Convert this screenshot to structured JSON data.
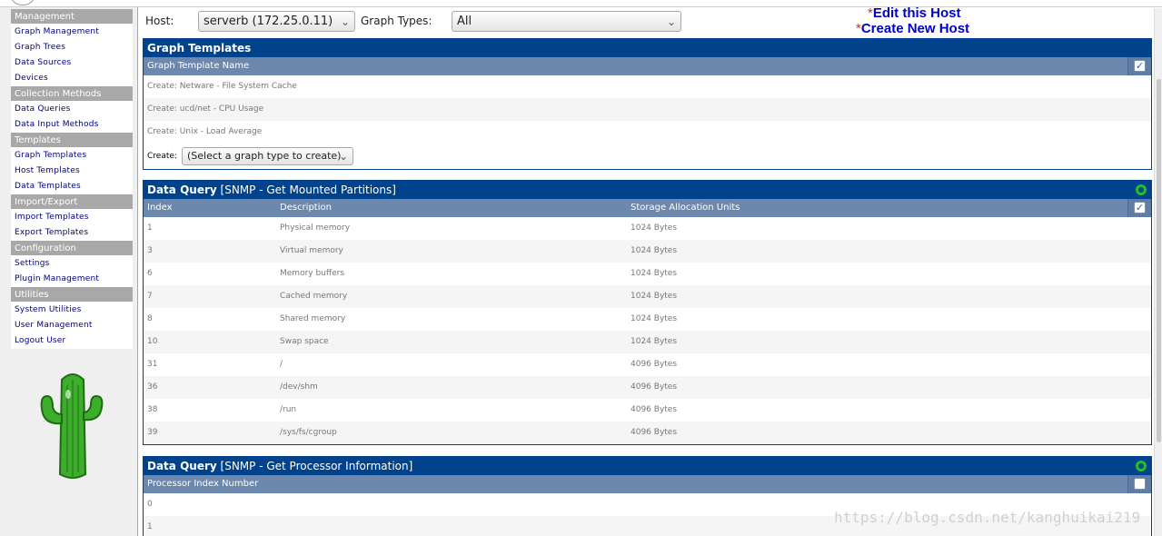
{
  "nav": {
    "sections": [
      {
        "title": "Management",
        "items": [
          "Graph Management",
          "Graph Trees",
          "Data Sources",
          "Devices"
        ]
      },
      {
        "title": "Collection Methods",
        "items": [
          "Data Queries",
          "Data Input Methods"
        ]
      },
      {
        "title": "Templates",
        "items": [
          "Graph Templates",
          "Host Templates",
          "Data Templates"
        ]
      },
      {
        "title": "Import/Export",
        "items": [
          "Import Templates",
          "Export Templates"
        ]
      },
      {
        "title": "Configuration",
        "items": [
          "Settings",
          "Plugin Management"
        ]
      },
      {
        "title": "Utilities",
        "items": [
          "System Utilities",
          "User Management",
          "Logout User"
        ]
      }
    ]
  },
  "hostbar": {
    "host_label": "Host:",
    "host_value": "serverb (172.25.0.11)",
    "graph_types_label": "Graph Types:",
    "graph_types_value": "All",
    "edit_host": "Edit this Host",
    "create_host": "Create New Host"
  },
  "graph_templates": {
    "title": "Graph Templates",
    "column": "Graph Template Name",
    "rows": [
      "Create: Netware - File System Cache",
      "Create: ucd/net - CPU Usage",
      "Create: Unix - Load Average"
    ],
    "create_label": "Create:",
    "create_select": "(Select a graph type to create)"
  },
  "dq1": {
    "title_bold": "Data Query",
    "title_rest": "[SNMP - Get Mounted Partitions]",
    "columns": [
      "Index",
      "Description",
      "Storage Allocation Units"
    ],
    "rows": [
      [
        "1",
        "Physical memory",
        "1024 Bytes"
      ],
      [
        "3",
        "Virtual memory",
        "1024 Bytes"
      ],
      [
        "6",
        "Memory buffers",
        "1024 Bytes"
      ],
      [
        "7",
        "Cached memory",
        "1024 Bytes"
      ],
      [
        "8",
        "Shared memory",
        "1024 Bytes"
      ],
      [
        "10",
        "Swap space",
        "1024 Bytes"
      ],
      [
        "31",
        "/",
        "4096 Bytes"
      ],
      [
        "36",
        "/dev/shm",
        "4096 Bytes"
      ],
      [
        "38",
        "/run",
        "4096 Bytes"
      ],
      [
        "39",
        "/sys/fs/cgroup",
        "4096 Bytes"
      ]
    ]
  },
  "dq2": {
    "title_bold": "Data Query",
    "title_rest": "[SNMP - Get Processor Information]",
    "column": "Processor Index Number",
    "rows": [
      "0",
      "1"
    ]
  },
  "watermark": "https://blog.csdn.net/kanghuikai219",
  "icons": {
    "select_all": "checkbox-checked-icon",
    "reload": "green-ring-icon",
    "chevron": "chevron-down-icon",
    "logo": "cactus-logo"
  }
}
